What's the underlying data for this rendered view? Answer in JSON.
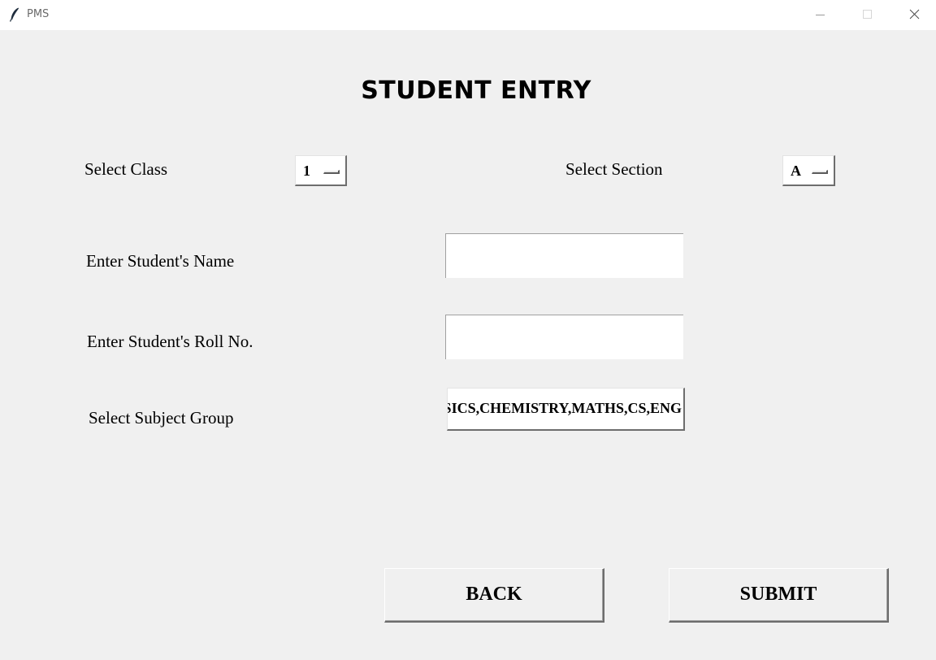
{
  "window": {
    "title": "PMS",
    "icon": "feather-icon"
  },
  "page": {
    "heading": "STUDENT ENTRY"
  },
  "form": {
    "class_label": "Select Class",
    "class_value": "1",
    "section_label": "Select Section",
    "section_value": "A",
    "name_label": "Enter Student's Name",
    "name_value": "",
    "roll_label": "Enter Student's Roll No.",
    "roll_value": "",
    "subject_label": "Select Subject Group",
    "subject_value": "PHYSICS,CHEMISTRY,MATHS,CS,ENG"
  },
  "buttons": {
    "back": "BACK",
    "submit": "SUBMIT"
  }
}
